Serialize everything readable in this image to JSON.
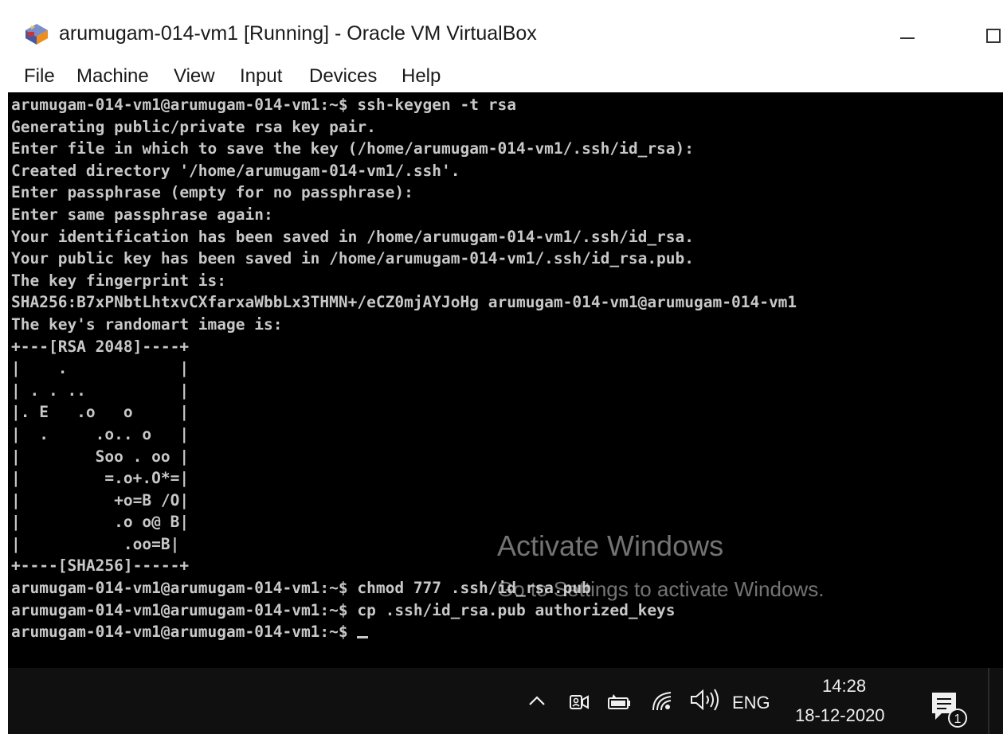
{
  "window": {
    "title": "arumugam-014-vm1 [Running] - Oracle VM VirtualBox",
    "icon": "virtualbox-logo-icon",
    "controls": [
      "minimize-icon",
      "maximize-icon"
    ]
  },
  "menubar": {
    "items": [
      "File",
      "Machine",
      "View",
      "Input",
      "Devices",
      "Help"
    ]
  },
  "terminal": {
    "lines": [
      "arumugam-014-vm1@arumugam-014-vm1:~$ ssh-keygen -t rsa",
      "Generating public/private rsa key pair.",
      "Enter file in which to save the key (/home/arumugam-014-vm1/.ssh/id_rsa):",
      "Created directory '/home/arumugam-014-vm1/.ssh'.",
      "Enter passphrase (empty for no passphrase):",
      "Enter same passphrase again:",
      "Your identification has been saved in /home/arumugam-014-vm1/.ssh/id_rsa.",
      "Your public key has been saved in /home/arumugam-014-vm1/.ssh/id_rsa.pub.",
      "The key fingerprint is:",
      "SHA256:B7xPNbtLhtxvCXfarxaWbbLx3THMN+/eCZ0mjAYJoHg arumugam-014-vm1@arumugam-014-vm1",
      "The key's randomart image is:",
      "+---[RSA 2048]----+",
      "|    .            |",
      "| . . ..          |",
      "|. E   .o   o     |",
      "|  .     .o.. o   |",
      "|        Soo . oo |",
      "|         =.o+.O*=|",
      "|          +o=B /O|",
      "|          .o o@ B|",
      "|           .oo=B|",
      "+----[SHA256]-----+",
      "arumugam-014-vm1@arumugam-014-vm1:~$ chmod 777 .ssh/id_rsa.pub",
      "arumugam-014-vm1@arumugam-014-vm1:~$ cp .ssh/id_rsa.pub authorized_keys",
      "arumugam-014-vm1@arumugam-014-vm1:~$ "
    ],
    "text_color": "#c8c8c8",
    "background": "#000000"
  },
  "watermark": {
    "title": "Activate Windows",
    "subtitle": "Go to Settings to activate Windows."
  },
  "taskbar": {
    "icons": [
      "chevron-up-icon",
      "meet-now-icon",
      "battery-icon",
      "wifi-icon",
      "volume-icon",
      "notification-icon"
    ],
    "language": "ENG",
    "time": "14:28",
    "date": "18-12-2020",
    "notification_count": "1"
  }
}
